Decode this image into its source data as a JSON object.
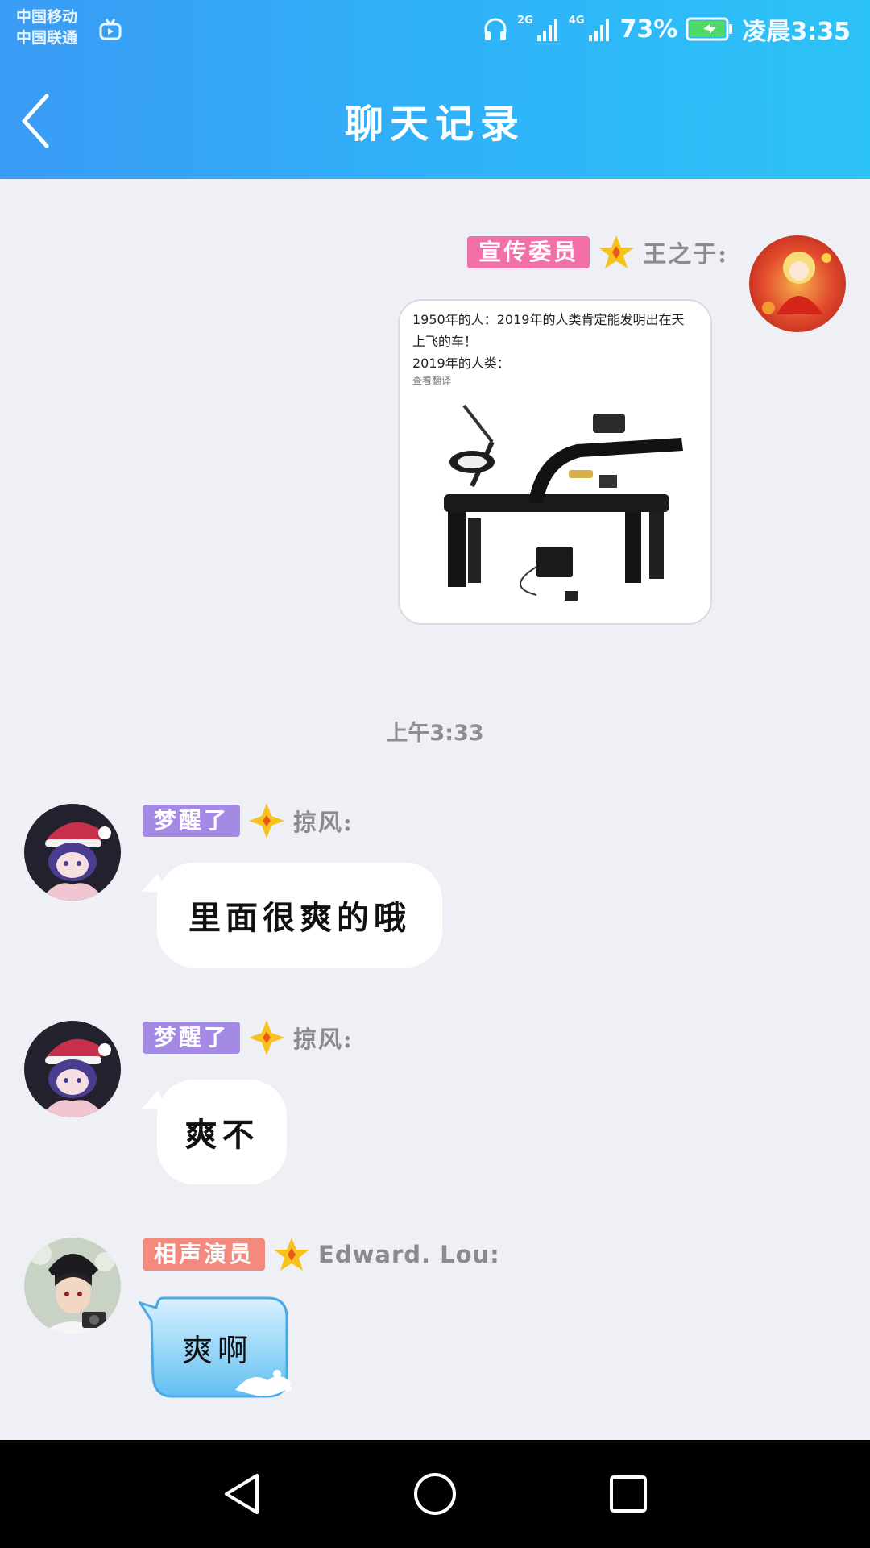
{
  "status_bar": {
    "carrier_1": "中国移动",
    "carrier_2": "中国联通",
    "net_1": "2G",
    "net_2": "4G",
    "battery": "73%",
    "time": "凌晨3:35"
  },
  "header": {
    "title": "聊天记录"
  },
  "messages": [
    {
      "badge": "宣传委员",
      "badge_color": "#f26fa7",
      "sender": "王之于:",
      "side": "right",
      "image": {
        "caption_line1": "1950年的人：2019年的人类肯定能发明出在天",
        "caption_line2": "上飞的车！",
        "caption_line3": "2019年的人类：",
        "caption_small": "查看翻译"
      }
    },
    {
      "time": "上午3:33"
    },
    {
      "badge": "梦醒了",
      "badge_color": "#a58ae5",
      "sender": "掠风:",
      "text": "里面很爽的哦"
    },
    {
      "badge": "梦醒了",
      "badge_color": "#a58ae5",
      "sender": "掠风:",
      "text": "爽不"
    },
    {
      "badge": "相声演员",
      "badge_color": "#f48a7d",
      "sender": "Edward. Lou:",
      "text": "爽啊"
    }
  ],
  "colors": {
    "header_start": "#3a9bf5",
    "header_end": "#2cc3f6",
    "background": "#eef0f5",
    "star": "#f7c21c"
  },
  "icons": [
    "back-arrow-icon",
    "headset-icon",
    "signal-icon",
    "battery-icon",
    "tv-icon",
    "star-icon",
    "nav-back-icon",
    "nav-home-icon",
    "nav-recents-icon"
  ]
}
